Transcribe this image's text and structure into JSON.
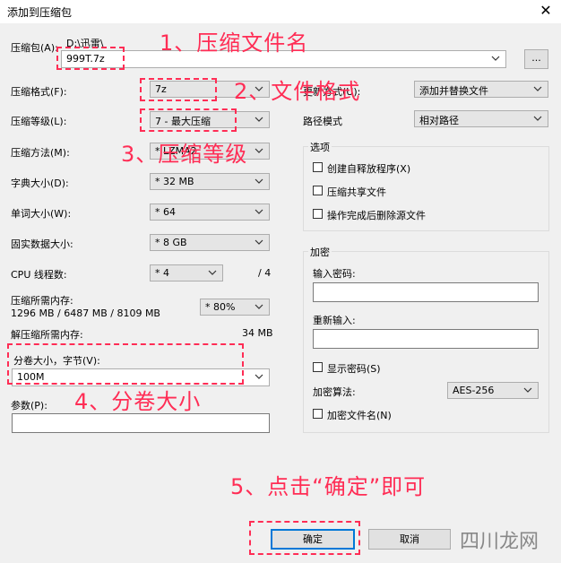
{
  "window": {
    "title": "添加到压缩包"
  },
  "archive": {
    "label": "压缩包(A):",
    "path": "D:\\迅雷\\",
    "name": "999T.7z",
    "browse": "..."
  },
  "format": {
    "label": "压缩格式(F):",
    "value": "7z"
  },
  "level": {
    "label": "压缩等级(L):",
    "value": "7 - 最大压缩"
  },
  "method": {
    "label": "压缩方法(M):",
    "value": "* LZMA2"
  },
  "dict": {
    "label": "字典大小(D):",
    "value": "* 32 MB"
  },
  "word": {
    "label": "单词大小(W):",
    "value": "* 64"
  },
  "solid": {
    "label": "固实数据大小:",
    "value": "* 8 GB"
  },
  "cpu": {
    "label": "CPU 线程数:",
    "value": "* 4",
    "total": "/ 4"
  },
  "mem": {
    "label": "压缩所需内存:",
    "detail": "1296 MB / 6487 MB / 8109 MB",
    "pct": "* 80%"
  },
  "decmem": {
    "label": "解压缩所需内存:",
    "value": "34 MB"
  },
  "volume": {
    "label": "分卷大小，字节(V):",
    "value": "100M"
  },
  "params": {
    "label": "参数(P):",
    "value": ""
  },
  "update": {
    "label": "更新方式(U):",
    "value": "添加并替换文件"
  },
  "pathmode": {
    "label": "路径模式",
    "value": "相对路径"
  },
  "options": {
    "title": "选项",
    "sfx": "创建自释放程序(X)",
    "shared": "压缩共享文件",
    "delete": "操作完成后删除源文件"
  },
  "encrypt": {
    "title": "加密",
    "pw_label": "输入密码:",
    "pw2_label": "重新输入:",
    "show_pw": "显示密码(S)",
    "algo_label": "加密算法:",
    "algo": "AES-256",
    "enc_names": "加密文件名(N)"
  },
  "buttons": {
    "ok": "确定",
    "cancel": "取消"
  },
  "annotations": {
    "a1": "1、压缩文件名",
    "a2": "2、文件格式",
    "a3": "3、压缩等级",
    "a4": "4、分卷大小",
    "a5": "5、点击“确定”即可"
  },
  "watermark": "四川龙网",
  "colors": {
    "annotation": "#ff2d55",
    "default_button_border": "#0078d7"
  }
}
